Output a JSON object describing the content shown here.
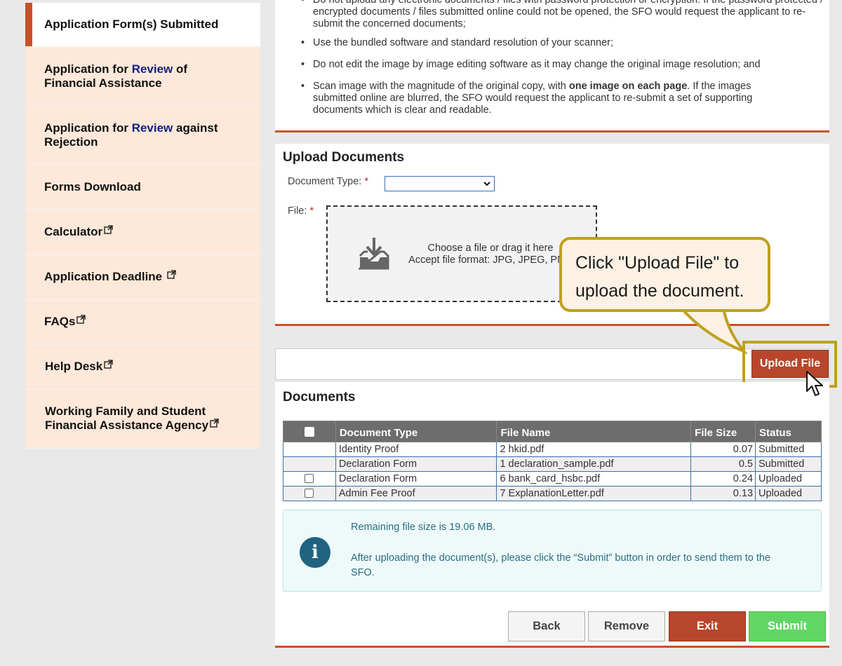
{
  "sidebar": {
    "items": [
      {
        "label": "Application Form(s) Submitted",
        "active": true
      },
      {
        "label_prefix": "Application for",
        "label_highlight": "Review",
        "label_suffix": "of",
        "label_line2": "Financial Assistance"
      },
      {
        "label_prefix": "Application for",
        "label_highlight": "Review",
        "label_suffix": "against",
        "label_line2": "Rejection"
      },
      {
        "label": "Forms Download"
      },
      {
        "label": "Calculator",
        "external": true
      },
      {
        "label": "Application Deadline",
        "external": true
      },
      {
        "label": "FAQs",
        "external": true
      },
      {
        "label": "Help Desk",
        "external": true
      },
      {
        "label": "Working Family and Student",
        "label_line2": "Financial Assistance Agency",
        "external": true
      }
    ]
  },
  "guidelines": {
    "item0": "Do not upload any electronic documents / files with password protection or encryption. If the password protected / encrypted documents / files submitted online could not be opened, the SFO would request the applicant to re-submit the concerned documents;",
    "item1": "Use the bundled software and standard resolution of your scanner;",
    "item2": "Do not edit the image by image editing software as it may change the original image resolution; and",
    "item3_a": "Scan image with the magnitude of the original copy, with ",
    "item3_bold": "one image on each page",
    "item3_b": ". If the images submitted online are blurred, the SFO would request the applicant to re-submit a set of supporting documents which is clear and readable."
  },
  "upload": {
    "title": "Upload Documents",
    "document_type_label": "Document Type:",
    "document_type_value": "",
    "file_label": "File:",
    "required_mark": "*",
    "drop_line1": "Choose a file or drag it here",
    "drop_line2": "Accept file format: JPG, JPEG, PNG",
    "upload_button": "Upload File"
  },
  "callout": {
    "line1": "Click \"Upload File\" to",
    "line2": "upload the document."
  },
  "documents": {
    "title": "Documents",
    "columns": [
      "Document Type",
      "File Name",
      "File Size",
      "Status"
    ],
    "rows": [
      {
        "type": "Identity Proof",
        "file": "2 hkid.pdf",
        "size": "0.07",
        "status": "Submitted",
        "checkbox": false
      },
      {
        "type": "Declaration Form",
        "file": "1 declaration_sample.pdf",
        "size": "0.5",
        "status": "Submitted",
        "checkbox": false
      },
      {
        "type": "Declaration Form",
        "file": "6 bank_card_hsbc.pdf",
        "size": "0.24",
        "status": "Uploaded",
        "checkbox": true
      },
      {
        "type": "Admin Fee Proof",
        "file": "7 ExplanationLetter.pdf",
        "size": "0.13",
        "status": "Uploaded",
        "checkbox": true
      }
    ]
  },
  "info": {
    "remaining": "Remaining file size is 19.06 MB.",
    "instruction_line1": "After uploading the document(s), please click the “Submit” button in order to send them to the",
    "instruction_line2": "SFO."
  },
  "actions": {
    "back": "Back",
    "remove": "Remove",
    "exit": "Exit",
    "submit": "Submit"
  },
  "colors": {
    "accent": "#c9512a",
    "sidebar_bg": "#fde8d9",
    "review_text": "#11217e",
    "exit_button": "#b8462c",
    "submit_button": "#62d665",
    "callout_border": "#c0a01e",
    "info_icon": "#1f6380"
  },
  "icons": {
    "external_link": "external-link-icon",
    "upload_tray": "download-tray-icon",
    "info": "info-icon",
    "cursor": "mouse-pointer-icon"
  }
}
